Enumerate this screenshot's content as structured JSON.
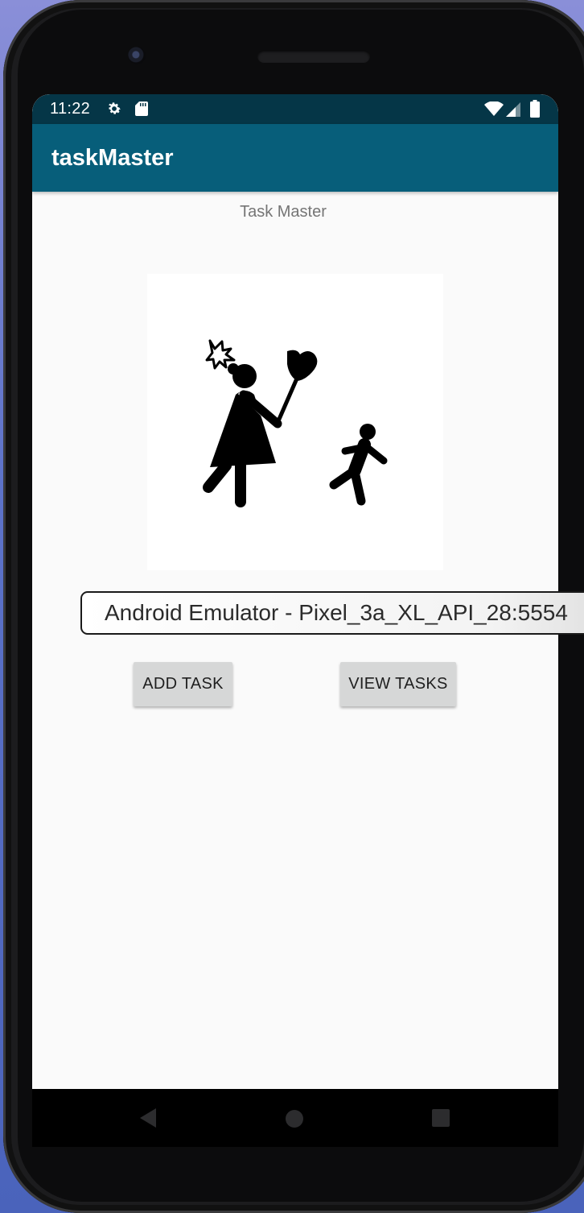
{
  "status_bar": {
    "time": "11:22",
    "icons": [
      "gear-icon",
      "sd-card-icon",
      "wifi-icon",
      "signal-icon",
      "battery-icon"
    ]
  },
  "app_bar": {
    "title": "taskMaster"
  },
  "main": {
    "subtitle": "Task Master",
    "image_icon": "mother-with-broom-chasing-child-icon",
    "buttons": {
      "add_task": "ADD TASK",
      "view_tasks": "VIEW TASKS"
    }
  },
  "nav_bar": {
    "icons": [
      "back-icon",
      "home-icon",
      "recents-icon"
    ]
  },
  "tooltip": {
    "text": "Android Emulator - Pixel_3a_XL_API_28:5554"
  },
  "colors": {
    "status_bar": "#053647",
    "app_bar": "#075e7a",
    "background": "#fafafa",
    "button": "#d6d7d7"
  }
}
